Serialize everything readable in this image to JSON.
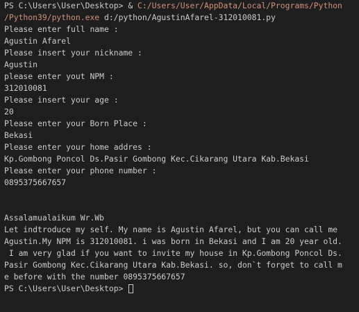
{
  "terminal": {
    "prompt": "PS C:\\Users\\User\\Desktop> ",
    "command_amp": "& ",
    "exe_path_line1": "C:/Users/User/AppData/Local/Programs/Python",
    "exe_path_line2": "/Python39/python.exe",
    "script_arg": " d:/python/AgustinAfarel-312010081.py",
    "colors": {
      "background": "#1e1e1e",
      "foreground": "#cccccc",
      "path": "#ce9178"
    },
    "io_lines": [
      "Please enter full name :",
      "Agustin Afarel",
      "Please insert your nickname :",
      "Agustin",
      "please enter yout NPM :",
      "312010081",
      "Please insert your age :",
      "20",
      "Please enter your Born Place :",
      "Bekasi",
      "Please enter your home addres :",
      "Kp.Gombong Poncol Ds.Pasir Gombong Kec.Cikarang Utara Kab.Bekasi",
      "Please enter your phone number :",
      "0895375667657"
    ],
    "output_lines": [
      "Assalamualaikum Wr.Wb",
      "Let indtroduce my self. My name is Agustin Afarel, but you can call me",
      "Agustin.My NPM is 312010081. i was born in Bekasi and I am 20 year old.",
      " I am very glad if you want to invite my house in Kp.Gombong Poncol Ds.",
      "Pasir Gombong Kec.Cikarang Utara Kab.Bekasi. so, don`t forget to call m",
      "e before with the number 0895375667657"
    ],
    "final_prompt": "PS C:\\Users\\User\\Desktop> "
  }
}
